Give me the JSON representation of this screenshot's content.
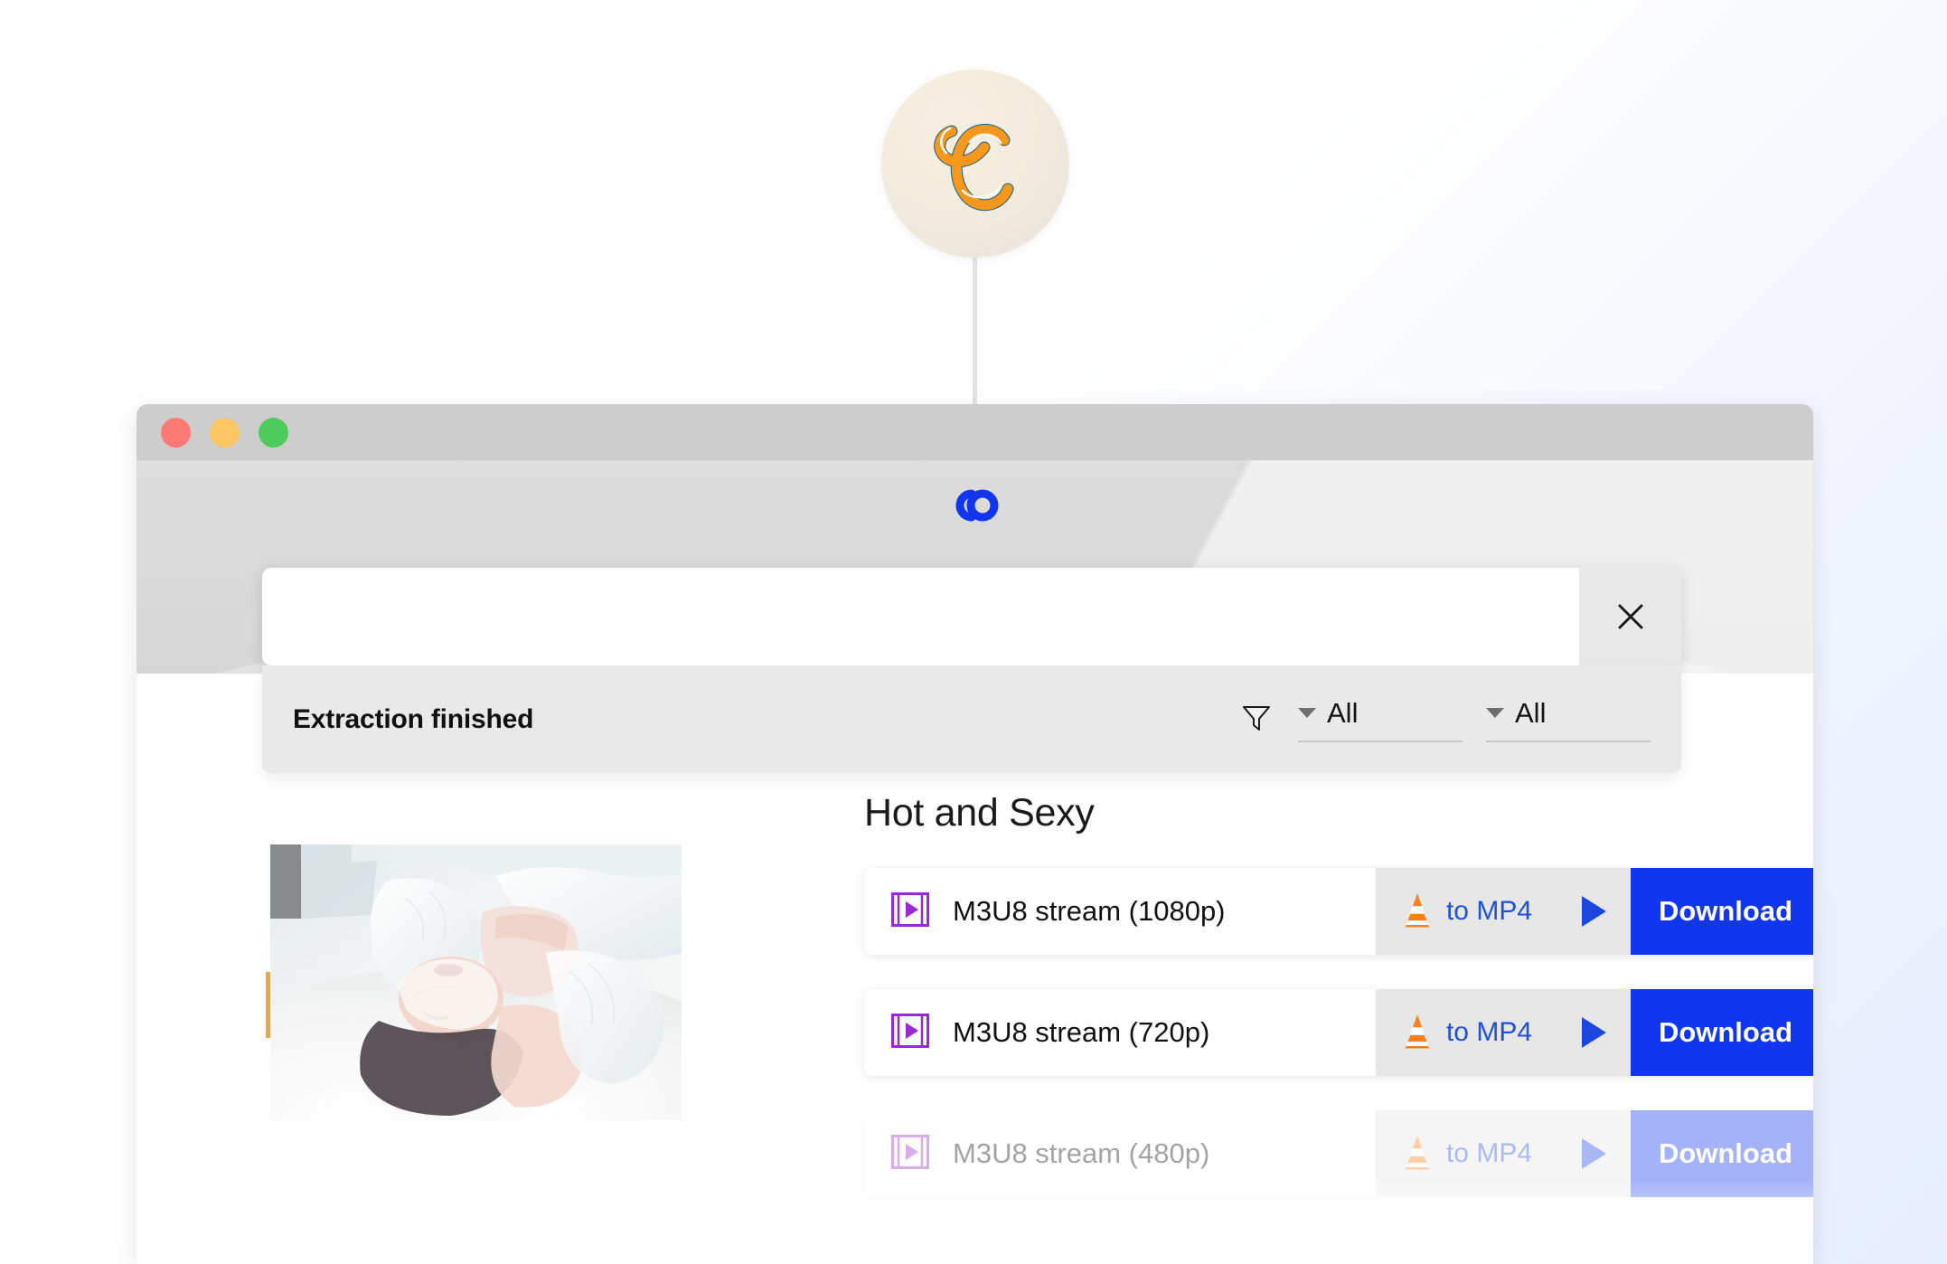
{
  "marker": {
    "icon_name": "app-logo-c-badge"
  },
  "window": {
    "traffic_lights": [
      "close",
      "minimize",
      "zoom"
    ],
    "brand_icon_name": "interlocking-rings-logo"
  },
  "search": {
    "value": "",
    "placeholder": "",
    "close_icon_name": "close-icon"
  },
  "status": {
    "text": "Extraction finished",
    "filter_icon_name": "filter-funnel-icon",
    "filters": [
      {
        "label": "All",
        "caret_icon_name": "chevron-down-icon"
      },
      {
        "label": "All",
        "caret_icon_name": "chevron-down-icon"
      }
    ]
  },
  "results": {
    "title": "Hot and Sexy",
    "thumbnail_alt": "video-thumbnail",
    "rows": [
      {
        "name": "M3U8 stream (1080p)",
        "video_icon_name": "video-file-icon",
        "convert_label": "to MP4",
        "convert_icon_name": "vlc-cone-icon",
        "play_icon_name": "play-icon",
        "download_label": "Download",
        "dimmed": false
      },
      {
        "name": "M3U8 stream (720p)",
        "video_icon_name": "video-file-icon",
        "convert_label": "to MP4",
        "convert_icon_name": "vlc-cone-icon",
        "play_icon_name": "play-icon",
        "download_label": "Download",
        "dimmed": false
      },
      {
        "name": "M3U8 stream (480p)",
        "video_icon_name": "video-file-icon",
        "convert_label": "to MP4",
        "convert_icon_name": "vlc-cone-icon",
        "play_icon_name": "play-icon",
        "download_label": "Download",
        "dimmed": true
      }
    ]
  },
  "colors": {
    "accent_blue": "#1236f0",
    "link_blue": "#1f4fe0",
    "vlc_orange": "#f58220",
    "video_purple": "#9c27d8",
    "traffic_red": "#fd7b72",
    "traffic_yellow": "#fcc664",
    "traffic_green": "#4dcb5d"
  }
}
